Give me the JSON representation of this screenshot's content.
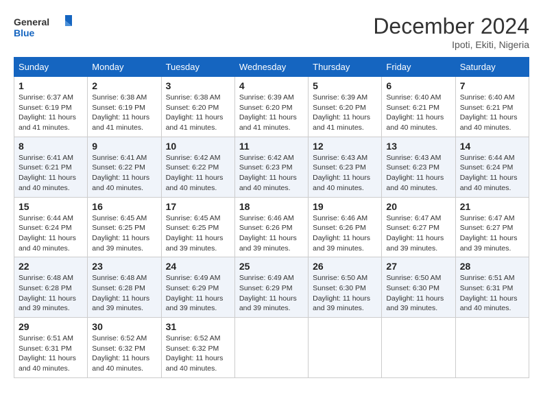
{
  "logo": {
    "general": "General",
    "blue": "Blue"
  },
  "title": "December 2024",
  "location": "Ipoti, Ekiti, Nigeria",
  "days_of_week": [
    "Sunday",
    "Monday",
    "Tuesday",
    "Wednesday",
    "Thursday",
    "Friday",
    "Saturday"
  ],
  "weeks": [
    [
      {
        "day": "1",
        "sunrise": "6:37 AM",
        "sunset": "6:19 PM",
        "daylight": "11 hours and 41 minutes."
      },
      {
        "day": "2",
        "sunrise": "6:38 AM",
        "sunset": "6:19 PM",
        "daylight": "11 hours and 41 minutes."
      },
      {
        "day": "3",
        "sunrise": "6:38 AM",
        "sunset": "6:20 PM",
        "daylight": "11 hours and 41 minutes."
      },
      {
        "day": "4",
        "sunrise": "6:39 AM",
        "sunset": "6:20 PM",
        "daylight": "11 hours and 41 minutes."
      },
      {
        "day": "5",
        "sunrise": "6:39 AM",
        "sunset": "6:20 PM",
        "daylight": "11 hours and 41 minutes."
      },
      {
        "day": "6",
        "sunrise": "6:40 AM",
        "sunset": "6:21 PM",
        "daylight": "11 hours and 40 minutes."
      },
      {
        "day": "7",
        "sunrise": "6:40 AM",
        "sunset": "6:21 PM",
        "daylight": "11 hours and 40 minutes."
      }
    ],
    [
      {
        "day": "8",
        "sunrise": "6:41 AM",
        "sunset": "6:21 PM",
        "daylight": "11 hours and 40 minutes."
      },
      {
        "day": "9",
        "sunrise": "6:41 AM",
        "sunset": "6:22 PM",
        "daylight": "11 hours and 40 minutes."
      },
      {
        "day": "10",
        "sunrise": "6:42 AM",
        "sunset": "6:22 PM",
        "daylight": "11 hours and 40 minutes."
      },
      {
        "day": "11",
        "sunrise": "6:42 AM",
        "sunset": "6:23 PM",
        "daylight": "11 hours and 40 minutes."
      },
      {
        "day": "12",
        "sunrise": "6:43 AM",
        "sunset": "6:23 PM",
        "daylight": "11 hours and 40 minutes."
      },
      {
        "day": "13",
        "sunrise": "6:43 AM",
        "sunset": "6:23 PM",
        "daylight": "11 hours and 40 minutes."
      },
      {
        "day": "14",
        "sunrise": "6:44 AM",
        "sunset": "6:24 PM",
        "daylight": "11 hours and 40 minutes."
      }
    ],
    [
      {
        "day": "15",
        "sunrise": "6:44 AM",
        "sunset": "6:24 PM",
        "daylight": "11 hours and 40 minutes."
      },
      {
        "day": "16",
        "sunrise": "6:45 AM",
        "sunset": "6:25 PM",
        "daylight": "11 hours and 39 minutes."
      },
      {
        "day": "17",
        "sunrise": "6:45 AM",
        "sunset": "6:25 PM",
        "daylight": "11 hours and 39 minutes."
      },
      {
        "day": "18",
        "sunrise": "6:46 AM",
        "sunset": "6:26 PM",
        "daylight": "11 hours and 39 minutes."
      },
      {
        "day": "19",
        "sunrise": "6:46 AM",
        "sunset": "6:26 PM",
        "daylight": "11 hours and 39 minutes."
      },
      {
        "day": "20",
        "sunrise": "6:47 AM",
        "sunset": "6:27 PM",
        "daylight": "11 hours and 39 minutes."
      },
      {
        "day": "21",
        "sunrise": "6:47 AM",
        "sunset": "6:27 PM",
        "daylight": "11 hours and 39 minutes."
      }
    ],
    [
      {
        "day": "22",
        "sunrise": "6:48 AM",
        "sunset": "6:28 PM",
        "daylight": "11 hours and 39 minutes."
      },
      {
        "day": "23",
        "sunrise": "6:48 AM",
        "sunset": "6:28 PM",
        "daylight": "11 hours and 39 minutes."
      },
      {
        "day": "24",
        "sunrise": "6:49 AM",
        "sunset": "6:29 PM",
        "daylight": "11 hours and 39 minutes."
      },
      {
        "day": "25",
        "sunrise": "6:49 AM",
        "sunset": "6:29 PM",
        "daylight": "11 hours and 39 minutes."
      },
      {
        "day": "26",
        "sunrise": "6:50 AM",
        "sunset": "6:30 PM",
        "daylight": "11 hours and 39 minutes."
      },
      {
        "day": "27",
        "sunrise": "6:50 AM",
        "sunset": "6:30 PM",
        "daylight": "11 hours and 39 minutes."
      },
      {
        "day": "28",
        "sunrise": "6:51 AM",
        "sunset": "6:31 PM",
        "daylight": "11 hours and 40 minutes."
      }
    ],
    [
      {
        "day": "29",
        "sunrise": "6:51 AM",
        "sunset": "6:31 PM",
        "daylight": "11 hours and 40 minutes."
      },
      {
        "day": "30",
        "sunrise": "6:52 AM",
        "sunset": "6:32 PM",
        "daylight": "11 hours and 40 minutes."
      },
      {
        "day": "31",
        "sunrise": "6:52 AM",
        "sunset": "6:32 PM",
        "daylight": "11 hours and 40 minutes."
      },
      null,
      null,
      null,
      null
    ]
  ],
  "labels": {
    "sunrise": "Sunrise:",
    "sunset": "Sunset:",
    "daylight": "Daylight: "
  }
}
